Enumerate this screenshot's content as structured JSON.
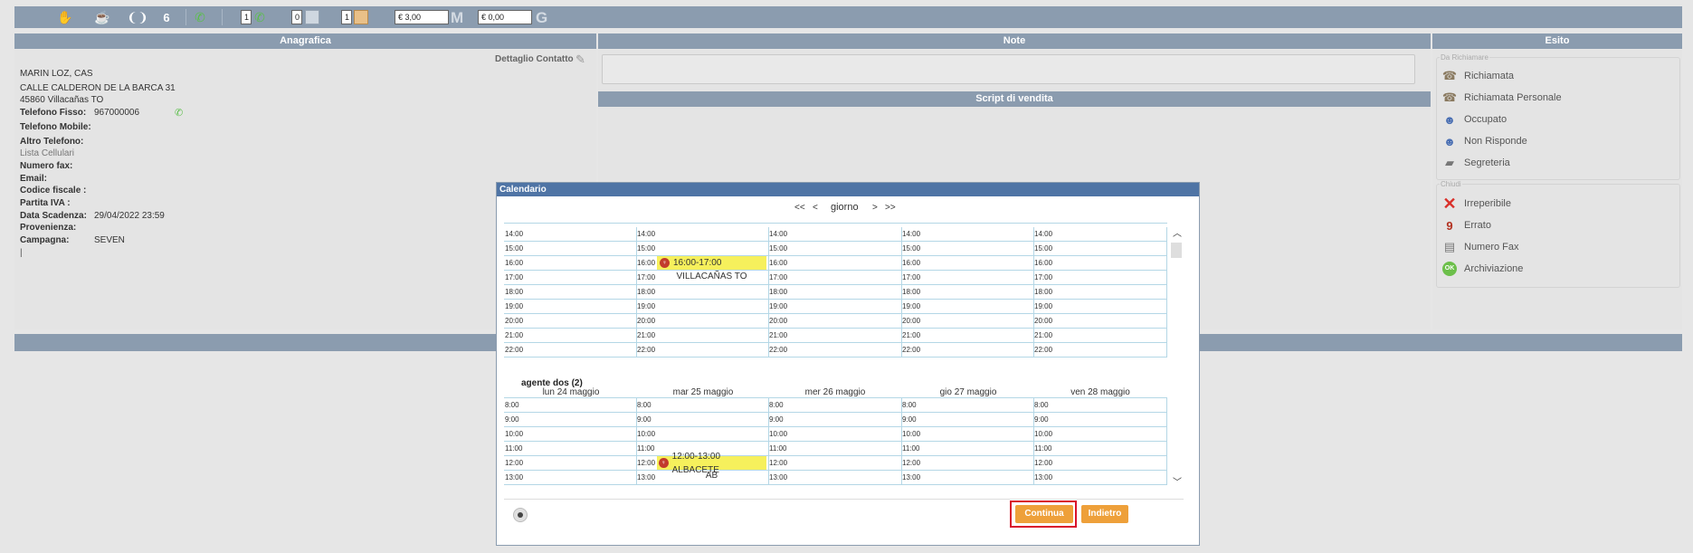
{
  "toolbar": {
    "count": "6",
    "box1": "1",
    "box2": "0",
    "box3": "1",
    "amount1": "€ 3,00",
    "amount1_suffix": "M",
    "amount2": "€ 0,00",
    "amount2_suffix": "G"
  },
  "anagrafica": {
    "title": "Anagrafica",
    "dettaglio": "Dettaglio Contatto",
    "name": "MARIN LOZ, CAS",
    "address1": "CALLE CALDERON DE LA BARCA 31",
    "address2": "45860 Villacañas TO",
    "telefono_fisso_label": "Telefono Fisso:",
    "telefono_fisso": "967000006",
    "telefono_mobile_label": "Telefono Mobile:",
    "altro_telefono_label": "Altro Telefono:",
    "lista_cellulari": "Lista Cellulari",
    "numero_fax_label": "Numero fax:",
    "email_label": "Email:",
    "codice_fiscale_label": "Codice fiscale :",
    "partita_iva_label": "Partita IVA :",
    "data_scadenza_label": "Data Scadenza:",
    "data_scadenza": "29/04/2022 23:59",
    "provenienza_label": "Provenienza:",
    "campagna_label": "Campagna:",
    "campagna": "SEVEN",
    "cursor": "|"
  },
  "note": {
    "title": "Note",
    "script_title": "Script di vendita"
  },
  "esito": {
    "title": "Esito",
    "group1_legend": "Da Richiamare",
    "group1": [
      {
        "label": "Richiamata",
        "icon": "phone-person-icon"
      },
      {
        "label": "Richiamata Personale",
        "icon": "phone-person-icon"
      },
      {
        "label": "Occupato",
        "icon": "busy-person-icon"
      },
      {
        "label": "Non Risponde",
        "icon": "no-answer-person-icon"
      },
      {
        "label": "Segreteria",
        "icon": "answering-machine-icon"
      }
    ],
    "group2_legend": "Chiudi",
    "group2": [
      {
        "label": "Irreperibile",
        "icon": "red-x-icon"
      },
      {
        "label": "Errato",
        "icon": "wrong-number-icon"
      },
      {
        "label": "Numero Fax",
        "icon": "fax-icon"
      },
      {
        "label": "Archiviazione",
        "icon": "ok-icon"
      }
    ]
  },
  "calendar": {
    "title": "Calendario",
    "nav_first": "<<",
    "nav_prev": "<",
    "nav_mode": "giorno",
    "nav_next": ">",
    "nav_last": ">>",
    "upper_hours": [
      "14:00",
      "15:00",
      "16:00",
      "17:00",
      "18:00",
      "19:00",
      "20:00",
      "21:00",
      "22:00"
    ],
    "upper_appt_time": "16:00-17:00",
    "upper_appt_place": "VILLACAÑAS TO",
    "agent_label": "agente dos (2)",
    "days": [
      "lun 24 maggio",
      "mar 25 maggio",
      "mer 26 maggio",
      "gio 27 maggio",
      "ven 28 maggio"
    ],
    "lower_hours": [
      "8:00",
      "9:00",
      "10:00",
      "11:00",
      "12:00",
      "13:00"
    ],
    "lower_appt_time": "12:00-13:00 ALBACETE",
    "lower_appt_place": "AB",
    "continua": "Continua",
    "indietro": "Indietro"
  }
}
